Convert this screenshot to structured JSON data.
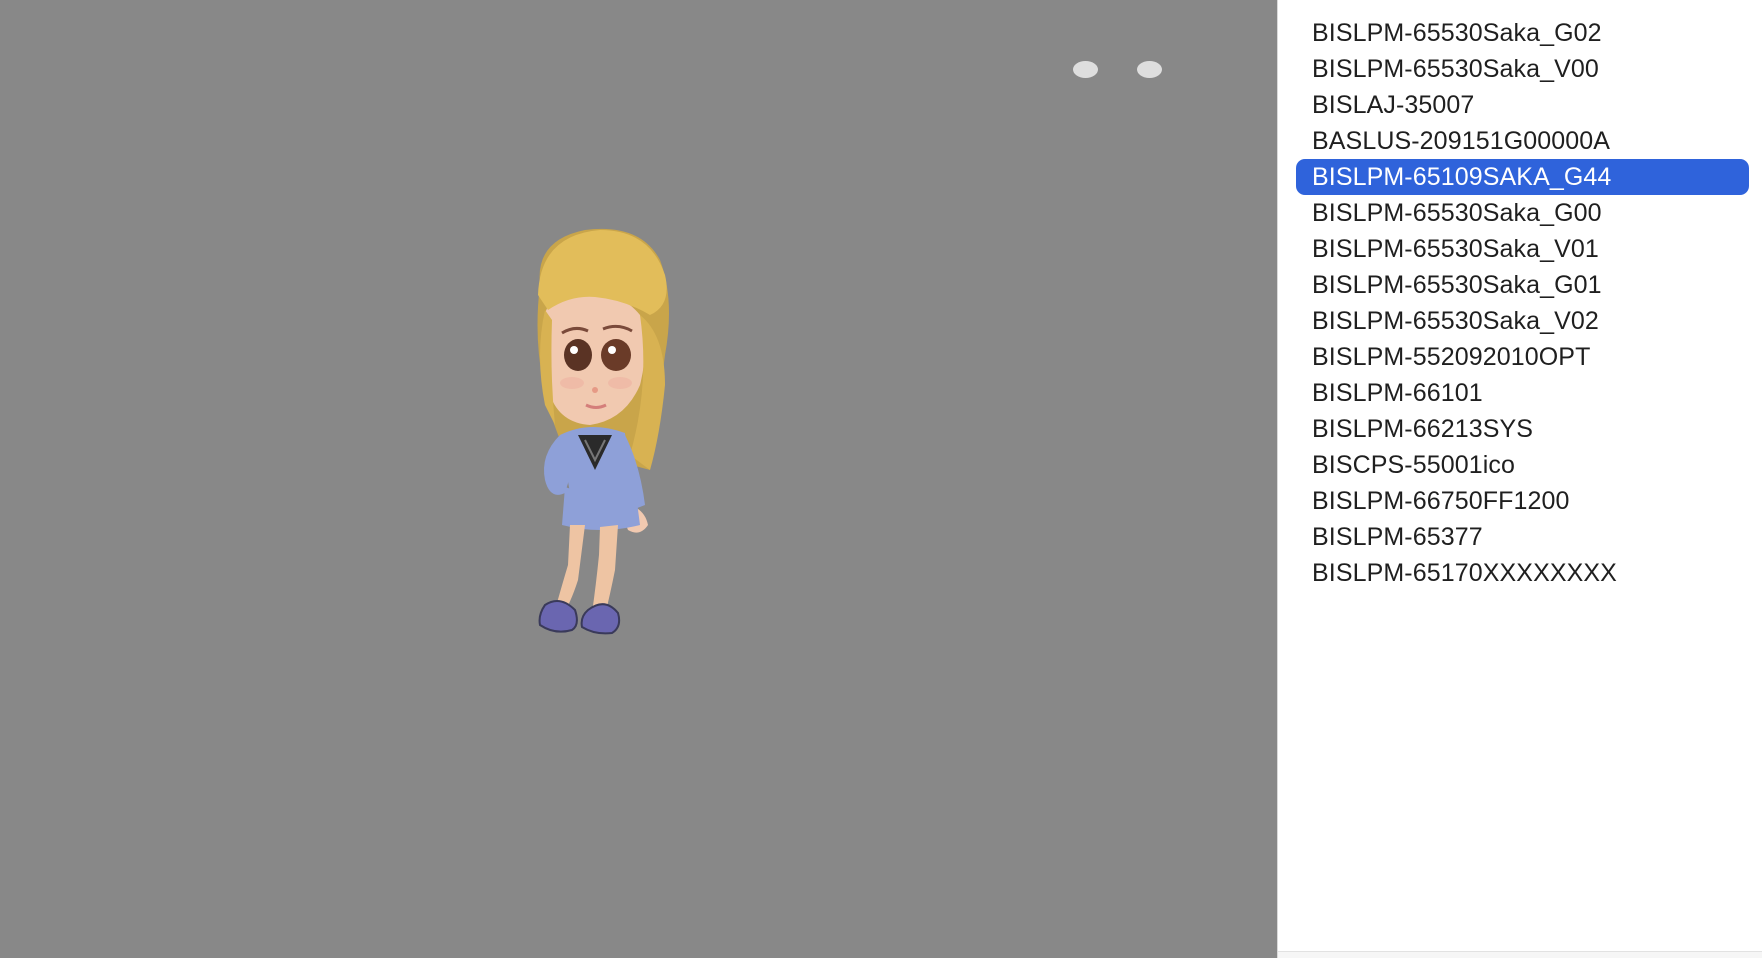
{
  "viewport": {
    "background": "#888888",
    "indicator_dots": 2
  },
  "model_list": {
    "selected_index": 4,
    "selected_color": "#2f63db",
    "items": [
      {
        "label": "BISLPM-65530Saka_G02"
      },
      {
        "label": "BISLPM-65530Saka_V00"
      },
      {
        "label": "BISLAJ-35007"
      },
      {
        "label": "BASLUS-209151G00000A"
      },
      {
        "label": "BISLPM-65109SAKA_G44"
      },
      {
        "label": "BISLPM-65530Saka_G00"
      },
      {
        "label": "BISLPM-65530Saka_V01"
      },
      {
        "label": "BISLPM-65530Saka_G01"
      },
      {
        "label": "BISLPM-65530Saka_V02"
      },
      {
        "label": "BISLPM-552092010OPT"
      },
      {
        "label": "BISLPM-66101"
      },
      {
        "label": "BISLPM-66213SYS"
      },
      {
        "label": "BISCPS-55001ico"
      },
      {
        "label": "BISLPM-66750FF1200"
      },
      {
        "label": "BISLPM-65377"
      },
      {
        "label": "BISLPM-65170XXXXXXXX"
      }
    ]
  }
}
